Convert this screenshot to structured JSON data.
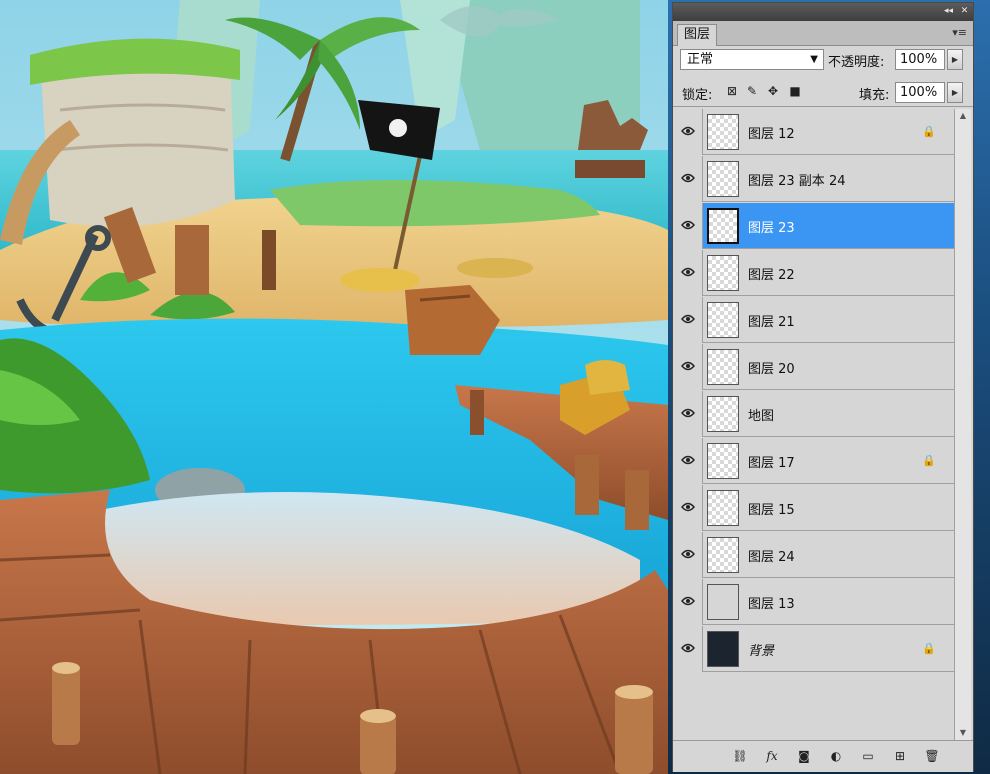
{
  "panel": {
    "tab_label": "图层",
    "blend_mode": "正常",
    "opacity_label": "不透明度:",
    "opacity_value": "100%",
    "lock_label": "锁定:",
    "fill_label": "填充:",
    "fill_value": "100%"
  },
  "layers": [
    {
      "name": "图层 12",
      "locked": true,
      "selected": false,
      "thumb": "transparent"
    },
    {
      "name": "图层 23 副本 24",
      "locked": false,
      "selected": false,
      "thumb": "transparent"
    },
    {
      "name": "图层 23",
      "locked": false,
      "selected": true,
      "thumb": "transparent"
    },
    {
      "name": "图层 22",
      "locked": false,
      "selected": false,
      "thumb": "transparent"
    },
    {
      "name": "图层 21",
      "locked": false,
      "selected": false,
      "thumb": "transparent"
    },
    {
      "name": "图层 20",
      "locked": false,
      "selected": false,
      "thumb": "transparent"
    },
    {
      "name": "地图",
      "locked": false,
      "selected": false,
      "thumb": "transparent"
    },
    {
      "name": "图层 17",
      "locked": true,
      "selected": false,
      "thumb": "transparent"
    },
    {
      "name": "图层 15",
      "locked": false,
      "selected": false,
      "thumb": "transparent"
    },
    {
      "name": "图层 24",
      "locked": false,
      "selected": false,
      "thumb": "transparent"
    },
    {
      "name": "图层 13",
      "locked": false,
      "selected": false,
      "thumb": "scene"
    },
    {
      "name": "背景",
      "locked": true,
      "selected": false,
      "thumb": "dark",
      "italic": true
    }
  ],
  "icons": {
    "titlebar": [
      "collapse-icon",
      "close-icon"
    ],
    "lock": [
      "lock-transparent-icon",
      "lock-paint-icon",
      "lock-move-icon",
      "lock-all-icon"
    ],
    "footer": [
      "link-icon",
      "fx-icon",
      "mask-icon",
      "adjustment-icon",
      "group-folder-icon",
      "new-layer-icon",
      "trash-icon"
    ]
  },
  "colors": {
    "selection": "#3b96f3",
    "panel_bg": "#d6d6d6"
  }
}
